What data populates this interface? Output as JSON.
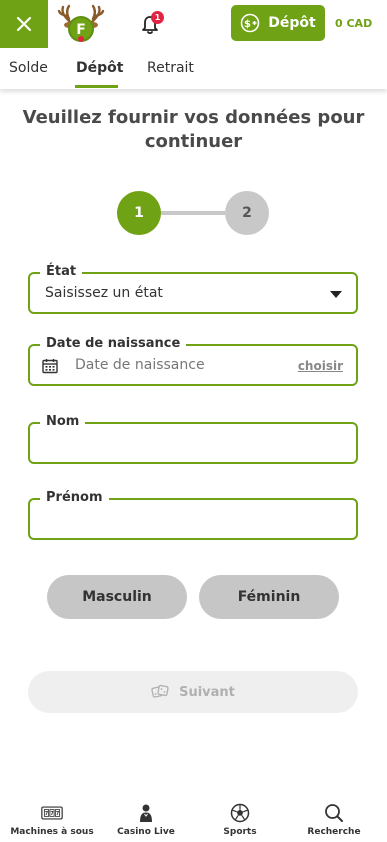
{
  "header": {
    "deposit_label": "Dépôt",
    "balance": "0 CAD",
    "notification_count": "1",
    "logo_letter": "F"
  },
  "tabs": [
    {
      "label": "Solde",
      "active": false
    },
    {
      "label": "Dépôt",
      "active": true
    },
    {
      "label": "Retrait",
      "active": false
    }
  ],
  "form": {
    "title": "Veuillez fournir vos données pour continuer",
    "steps": [
      "1",
      "2"
    ],
    "current_step": 1,
    "state": {
      "label": "État",
      "value": "Saisissez un état"
    },
    "birthdate": {
      "label": "Date de naissance",
      "placeholder": "Date de naissance",
      "choose_label": "choisir"
    },
    "last_name": {
      "label": "Nom",
      "value": ""
    },
    "first_name": {
      "label": "Prénom",
      "value": ""
    },
    "gender_options": [
      "Masculin",
      "Féminin"
    ],
    "next_label": "Suivant"
  },
  "bottom_nav": [
    {
      "label": "Machines à sous",
      "icon": "slot-machine-icon"
    },
    {
      "label": "Casino Live",
      "icon": "dealer-icon"
    },
    {
      "label": "Sports",
      "icon": "soccer-ball-icon"
    },
    {
      "label": "Recherche",
      "icon": "search-icon"
    }
  ],
  "colors": {
    "accent": "#6fa214",
    "badge": "#e02442",
    "disabled_button": "#efefef",
    "gender_button": "#c6c6c6"
  }
}
